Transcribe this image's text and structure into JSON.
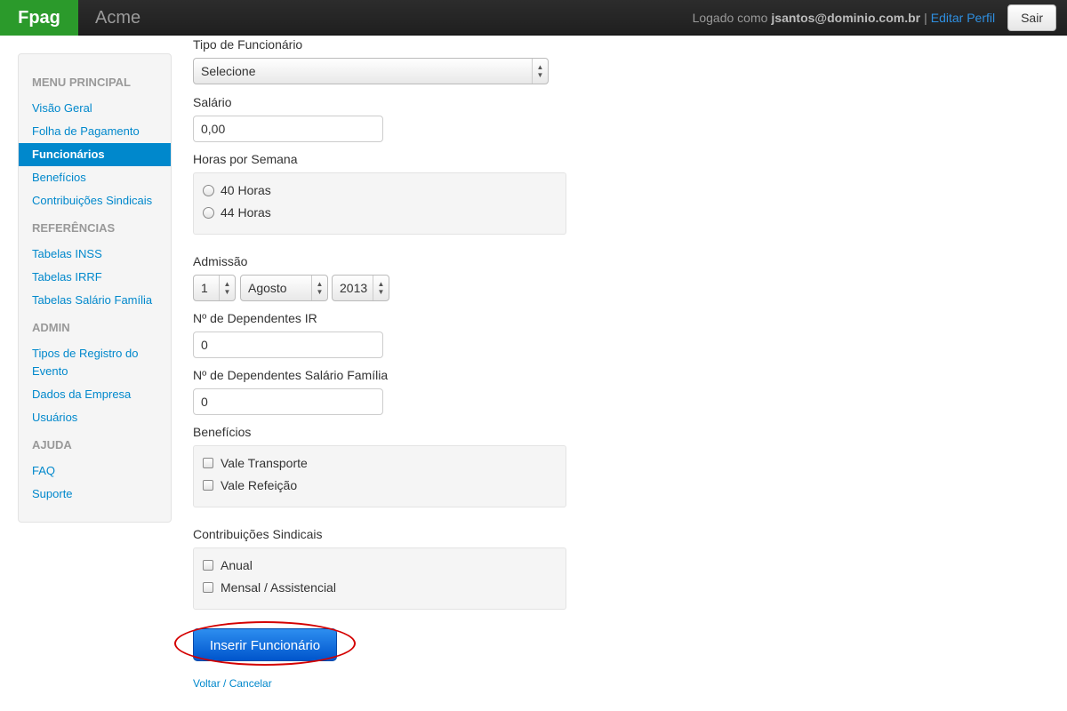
{
  "navbar": {
    "brand": "Fpag",
    "company": "Acme",
    "logged_as_prefix": "Logado como",
    "user": "jsantos@dominio.com.br",
    "separator": "|",
    "edit_profile": "Editar Perfil",
    "logout": "Sair"
  },
  "sidebar": {
    "sections": [
      {
        "header": "Menu Principal",
        "items": [
          "Visão Geral",
          "Folha de Pagamento",
          "Funcionários",
          "Benefícios",
          "Contribuições Sindicais"
        ]
      },
      {
        "header": "Referências",
        "items": [
          "Tabelas INSS",
          "Tabelas IRRF",
          "Tabelas Salário Família"
        ]
      },
      {
        "header": "Admin",
        "items": [
          "Tipos de Registro do Evento",
          "Dados da Empresa",
          "Usuários"
        ]
      },
      {
        "header": "Ajuda",
        "items": [
          "FAQ",
          "Suporte"
        ]
      }
    ],
    "active_item": "Funcionários"
  },
  "form": {
    "tipo_label": "Tipo de Funcionário",
    "tipo_value": "Selecione",
    "salario_label": "Salário",
    "salario_value": "0,00",
    "horas_label": "Horas por Semana",
    "horas_options": [
      "40 Horas",
      "44 Horas"
    ],
    "admissao_label": "Admissão",
    "admissao_day": "1",
    "admissao_month": "Agosto",
    "admissao_year": "2013",
    "dep_ir_label": "Nº de Dependentes IR",
    "dep_ir_value": "0",
    "dep_sf_label": "Nº de Dependentes Salário Família",
    "dep_sf_value": "0",
    "beneficios_label": "Benefícios",
    "beneficios_options": [
      "Vale Transporte",
      "Vale Refeição"
    ],
    "contrib_label": "Contribuições Sindicais",
    "contrib_options": [
      "Anual",
      "Mensal / Assistencial"
    ],
    "submit": "Inserir Funcionário",
    "cancel": "Voltar / Cancelar"
  },
  "colors": {
    "brand_bg": "#2b9a2b",
    "accent": "#0088cc",
    "submit_bg": "#0066dd",
    "highlight": "#d40000"
  }
}
